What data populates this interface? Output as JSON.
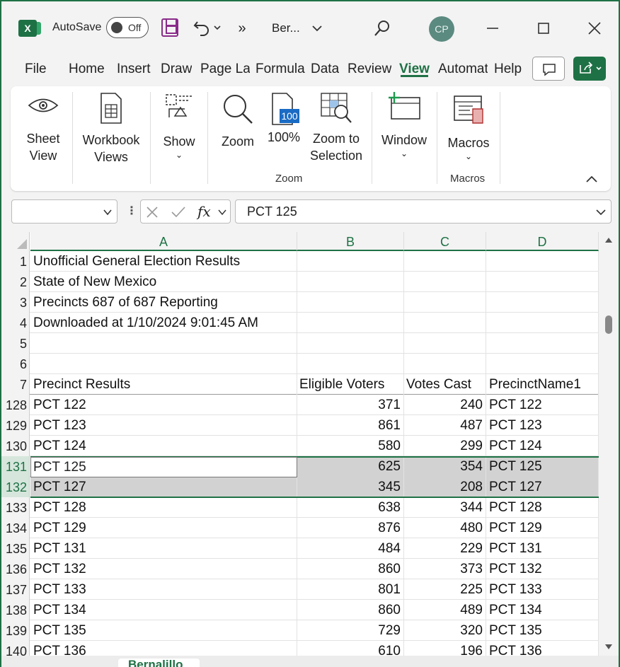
{
  "titlebar": {
    "autosave_label": "AutoSave",
    "autosave_state": "Off",
    "more_label": "»",
    "doc_title": "Ber...",
    "profile_initials": "CP",
    "brand_color": "#1e7145"
  },
  "menu": {
    "tabs": [
      "File",
      "Home",
      "Insert",
      "Draw",
      "Page Layout",
      "Formulas",
      "Data",
      "Review",
      "View",
      "Automate",
      "Help"
    ],
    "active": "View"
  },
  "ribbon": {
    "sheet_view": "Sheet View",
    "workbook_views": "Workbook Views",
    "show": "Show",
    "zoom": "Zoom",
    "zoom_100": "100%",
    "zoom_100_icon": "100",
    "zoom_selection": "Zoom to Selection",
    "window": "Window",
    "macros": "Macros",
    "group_zoom": "Zoom",
    "group_macros": "Macros"
  },
  "formula_bar": {
    "name_box": "",
    "fx": "fx",
    "value": "PCT 125"
  },
  "columns": [
    "A",
    "B",
    "C",
    "D"
  ],
  "rows": [
    {
      "n": "1",
      "a": "Unofficial General Election Results",
      "b": "",
      "c": "",
      "d": ""
    },
    {
      "n": "2",
      "a": "State of New Mexico",
      "b": "",
      "c": "",
      "d": ""
    },
    {
      "n": "3",
      "a": "Precincts 687 of 687 Reporting",
      "b": "",
      "c": "",
      "d": ""
    },
    {
      "n": "4",
      "a": "Downloaded at 1/10/2024 9:01:45 AM",
      "b": "",
      "c": "",
      "d": ""
    },
    {
      "n": "5",
      "a": "",
      "b": "",
      "c": "",
      "d": ""
    },
    {
      "n": "6",
      "a": "",
      "b": "",
      "c": "",
      "d": ""
    },
    {
      "n": "7",
      "a": "Precinct Results",
      "b": "Eligible Voters",
      "c": "Votes Cast",
      "d": "PrecinctName1"
    },
    {
      "n": "128",
      "a": "PCT 122",
      "b": "371",
      "c": "240",
      "d": "PCT 122"
    },
    {
      "n": "129",
      "a": "PCT 123",
      "b": "861",
      "c": "487",
      "d": "PCT 123"
    },
    {
      "n": "130",
      "a": "PCT 124",
      "b": "580",
      "c": "299",
      "d": "PCT 124"
    },
    {
      "n": "131",
      "a": "PCT 125",
      "b": "625",
      "c": "354",
      "d": "PCT 125"
    },
    {
      "n": "132",
      "a": "PCT 127",
      "b": "345",
      "c": "208",
      "d": "PCT 127"
    },
    {
      "n": "133",
      "a": "PCT 128",
      "b": "638",
      "c": "344",
      "d": "PCT 128"
    },
    {
      "n": "134",
      "a": "PCT 129",
      "b": "876",
      "c": "480",
      "d": "PCT 129"
    },
    {
      "n": "135",
      "a": "PCT 131",
      "b": "484",
      "c": "229",
      "d": "PCT 131"
    },
    {
      "n": "136",
      "a": "PCT 132",
      "b": "860",
      "c": "373",
      "d": "PCT 132"
    },
    {
      "n": "137",
      "a": "PCT 133",
      "b": "801",
      "c": "225",
      "d": "PCT 133"
    },
    {
      "n": "138",
      "a": "PCT 134",
      "b": "860",
      "c": "489",
      "d": "PCT 134"
    },
    {
      "n": "139",
      "a": "PCT 135",
      "b": "729",
      "c": "320",
      "d": "PCT 135"
    },
    {
      "n": "140",
      "a": "PCT 136",
      "b": "610",
      "c": "196",
      "d": "PCT 136"
    }
  ],
  "selected_rows": [
    "131",
    "132"
  ],
  "active_cell": "A131",
  "sheet_tab": "Bernalillo"
}
